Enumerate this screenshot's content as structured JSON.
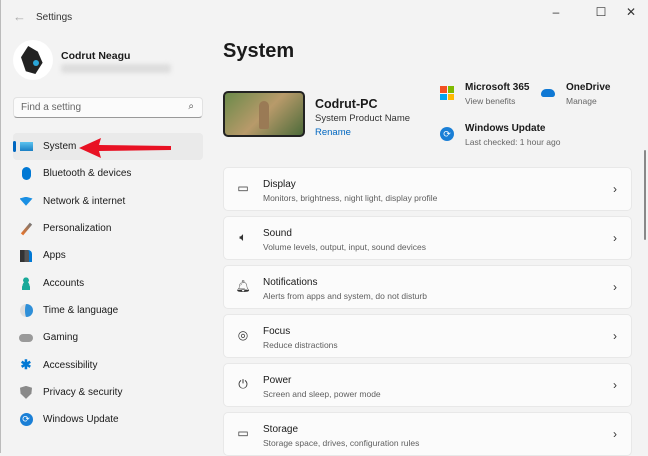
{
  "window": {
    "title": "Settings",
    "back_icon": "←",
    "minimize": "–",
    "maximize": "☐",
    "close": "✕"
  },
  "user": {
    "name": "Codrut Neagu"
  },
  "search": {
    "placeholder": "Find a setting",
    "icon": "⌕"
  },
  "sidebar": {
    "items": [
      {
        "label": "System",
        "icon": "system-icon",
        "selected": true
      },
      {
        "label": "Bluetooth & devices",
        "icon": "bluetooth-icon"
      },
      {
        "label": "Network & internet",
        "icon": "wifi-icon"
      },
      {
        "label": "Personalization",
        "icon": "brush-icon"
      },
      {
        "label": "Apps",
        "icon": "apps-icon"
      },
      {
        "label": "Accounts",
        "icon": "accounts-icon"
      },
      {
        "label": "Time & language",
        "icon": "time-icon"
      },
      {
        "label": "Gaming",
        "icon": "gaming-icon"
      },
      {
        "label": "Accessibility",
        "icon": "accessibility-icon"
      },
      {
        "label": "Privacy & security",
        "icon": "shield-icon"
      },
      {
        "label": "Windows Update",
        "icon": "update-icon"
      }
    ]
  },
  "main": {
    "title": "System",
    "device": {
      "name": "Codrut-PC",
      "model": "System Product Name",
      "rename": "Rename"
    },
    "tiles": [
      {
        "title": "Microsoft 365",
        "subtitle": "View benefits"
      },
      {
        "title": "OneDrive",
        "subtitle": "Manage"
      },
      {
        "title": "Windows Update",
        "subtitle": "Last checked: 1 hour ago"
      }
    ],
    "cards": [
      {
        "title": "Display",
        "subtitle": "Monitors, brightness, night light, display profile",
        "icon": "▭"
      },
      {
        "title": "Sound",
        "subtitle": "Volume levels, output, input, sound devices",
        "icon": "🔈︎"
      },
      {
        "title": "Notifications",
        "subtitle": "Alerts from apps and system, do not disturb",
        "icon": "🔔︎"
      },
      {
        "title": "Focus",
        "subtitle": "Reduce distractions",
        "icon": "◎"
      },
      {
        "title": "Power",
        "subtitle": "Screen and sleep, power mode",
        "icon": "⏻"
      },
      {
        "title": "Storage",
        "subtitle": "Storage space, drives, configuration rules",
        "icon": "▭"
      }
    ],
    "chevron": "›"
  },
  "colors": {
    "accent": "#0067c0",
    "arrow": "#e81123"
  }
}
